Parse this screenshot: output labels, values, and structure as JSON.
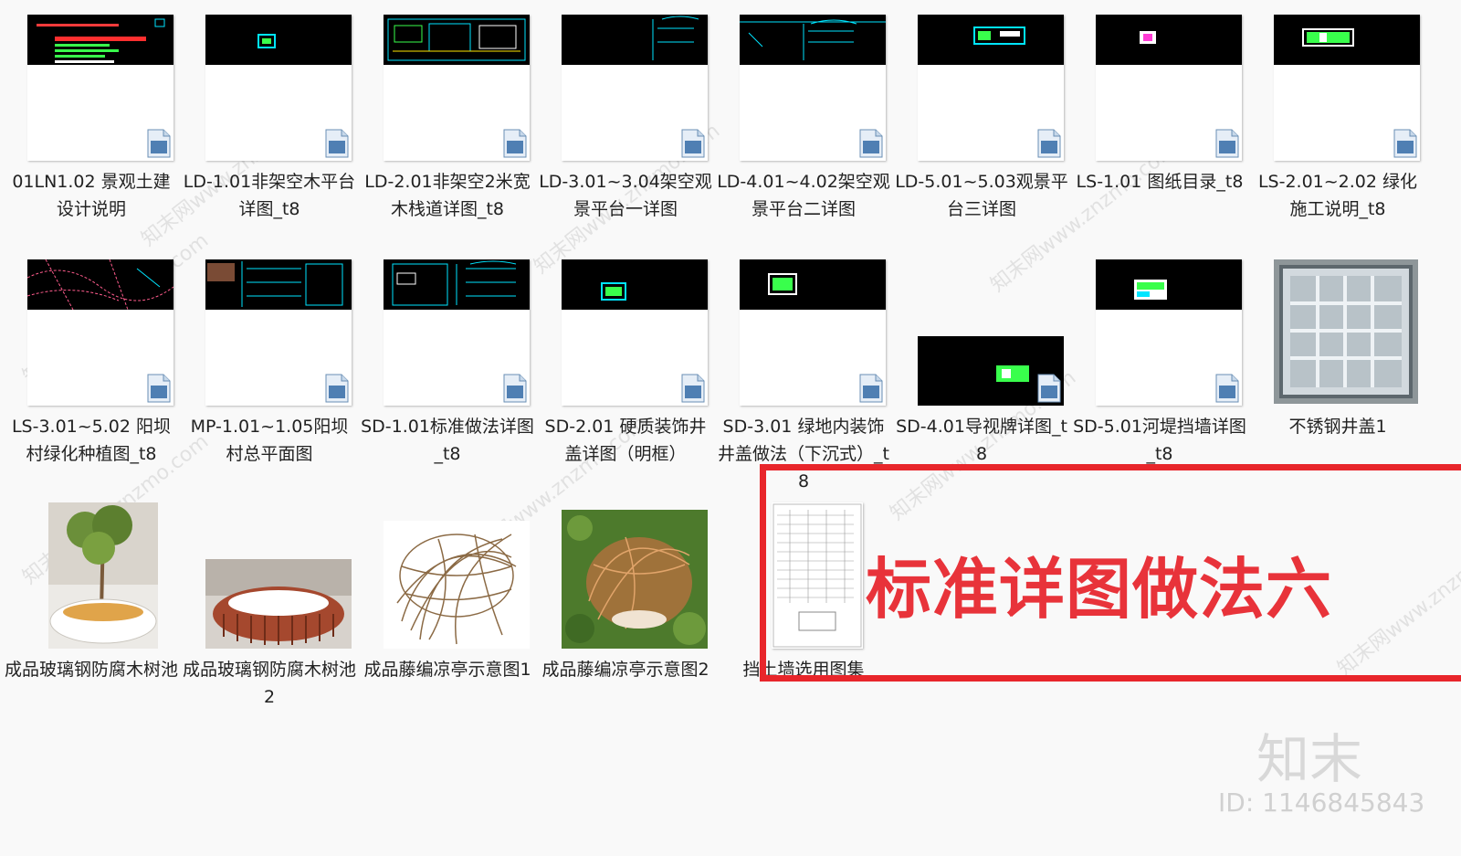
{
  "files": [
    {
      "label": "01LN1.02 景观土建设计说明"
    },
    {
      "label": "LD-1.01非架空木平台详图_t8"
    },
    {
      "label": "LD-2.01非架空2米宽木栈道详图_t8"
    },
    {
      "label": "LD-3.01~3.04架空观景平台一详图"
    },
    {
      "label": "LD-4.01~4.02架空观景平台二详图"
    },
    {
      "label": "LD-5.01~5.03观景平台三详图"
    },
    {
      "label": "LS-1.01 图纸目录_t8"
    },
    {
      "label": "LS-2.01~2.02 绿化施工说明_t8"
    },
    {
      "label": "LS-3.01~5.02 阳坝村绿化种植图_t8"
    },
    {
      "label": "MP-1.01~1.05阳坝村总平面图"
    },
    {
      "label": "SD-1.01标准做法详图_t8"
    },
    {
      "label": "SD-2.01 硬质装饰井盖详图（明框）"
    },
    {
      "label": "SD-3.01 绿地内装饰井盖做法（下沉式）_t8"
    },
    {
      "label": "SD-4.01导视牌详图_t8"
    },
    {
      "label": "SD-5.01河堤挡墙详图_t8"
    },
    {
      "label": "不锈钢井盖1"
    },
    {
      "label": "成品玻璃钢防腐木树池"
    },
    {
      "label": "成品玻璃钢防腐木树池2"
    },
    {
      "label": "成品藤编凉亭示意图1"
    },
    {
      "label": "成品藤编凉亭示意图2"
    },
    {
      "label": "挡土墙选用图集"
    }
  ],
  "banner": {
    "text": "标准详图做法六"
  },
  "brand": {
    "logo_text": "知末",
    "id_text": "ID: 1146845843"
  },
  "watermark": {
    "text": "知末网www.znzmo.com"
  },
  "colors": {
    "highlight": "#e8262b",
    "cad_line": "#00e5ff"
  }
}
